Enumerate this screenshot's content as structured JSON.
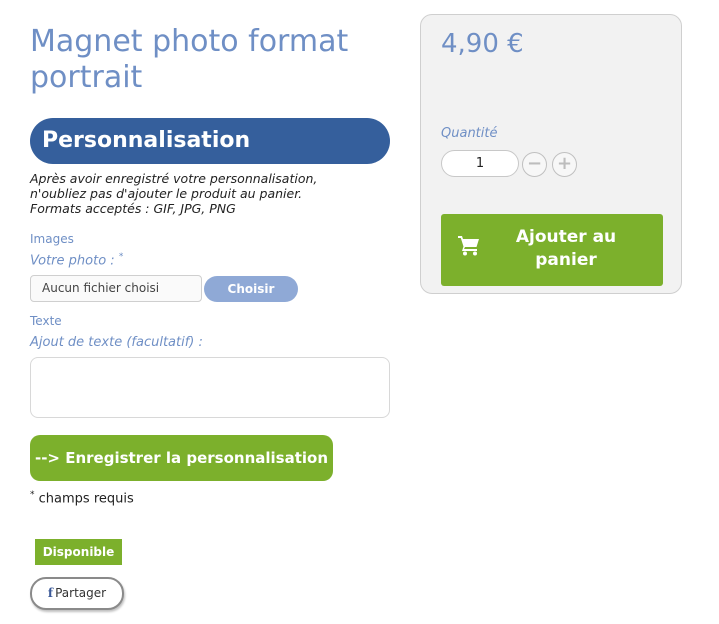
{
  "product": {
    "title": "Magnet photo format portrait"
  },
  "personalisation": {
    "header": "Personnalisation",
    "instructions": [
      "Après avoir enregistré votre personnalisation,",
      "n'oubliez pas d'ajouter le produit au panier.",
      "Formats acceptés : GIF, JPG, PNG"
    ],
    "images_section": "Images",
    "photo_label": "Votre photo :",
    "required_mark": "*",
    "file_placeholder": "Aucun fichier choisi",
    "choose_label": "Choisir",
    "text_section": "Texte",
    "text_label": "Ajout de texte (facultatif) :",
    "save_label": "--> Enregistrer la personnalisation",
    "required_note": "champs requis"
  },
  "availability": {
    "label": "Disponible",
    "color": "#7cb02c"
  },
  "share": {
    "label": "Partager",
    "icon": "facebook-icon"
  },
  "purchase": {
    "price": "4,90 €",
    "quantity_label": "Quantité",
    "quantity_value": "1",
    "minus_label": "−",
    "plus_label": "+",
    "add_to_cart_label": "Ajouter au panier",
    "cart_icon": "shopping-cart-icon"
  },
  "colors": {
    "accent_blue": "#6f8fc5",
    "header_blue": "#355f9c",
    "button_green": "#7cb02c"
  }
}
